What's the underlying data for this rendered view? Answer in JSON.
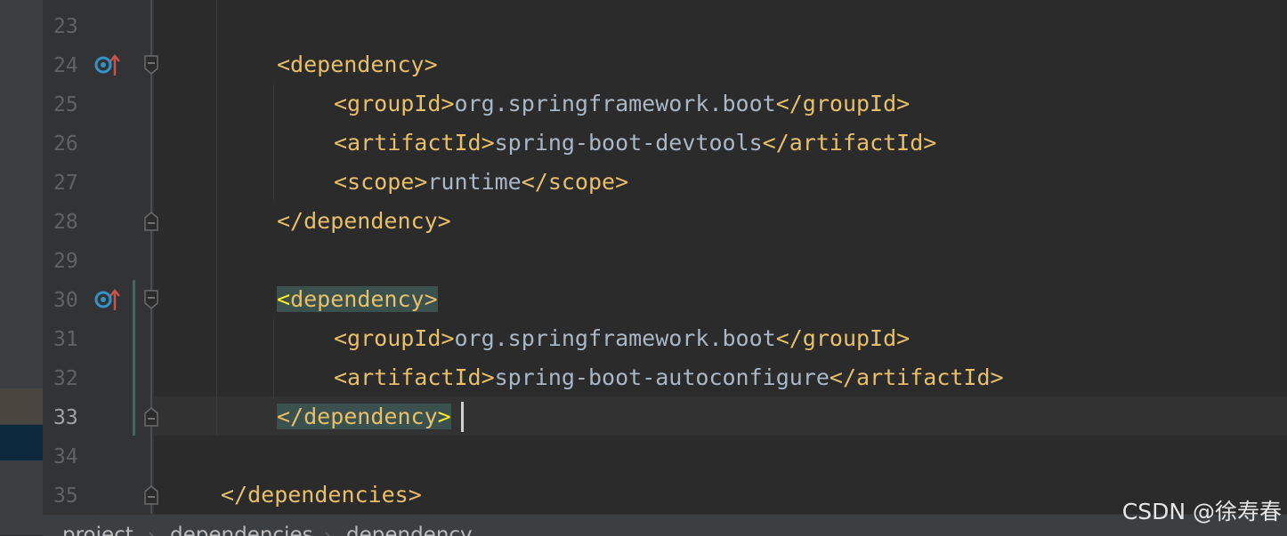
{
  "editor": {
    "lines": [
      {
        "number": "23"
      },
      {
        "number": "24",
        "tag_open": "<dependency>"
      },
      {
        "number": "25",
        "open": "<groupId>",
        "value": "org.springframework.boot",
        "close": "</groupId>"
      },
      {
        "number": "26",
        "open": "<artifactId>",
        "value": "spring-boot-devtools",
        "close": "</artifactId>"
      },
      {
        "number": "27",
        "open": "<scope>",
        "value": "runtime",
        "close": "</scope>"
      },
      {
        "number": "28",
        "tag_close": "</dependency>"
      },
      {
        "number": "29"
      },
      {
        "number": "30",
        "tag_open_lt": "<",
        "tag_open_rest": "dependency>"
      },
      {
        "number": "31",
        "open": "<groupId>",
        "value": "org.springframework.boot",
        "close": "</groupId>"
      },
      {
        "number": "32",
        "open": "<artifactId>",
        "value": "spring-boot-autoconfigure",
        "close": "</artifactId>"
      },
      {
        "number": "33",
        "tag_close_main": "</dependency",
        "tag_close_gt": ">"
      },
      {
        "number": "34"
      },
      {
        "number": "35",
        "tag_close": "</dependencies>"
      }
    ],
    "current_line": "33"
  },
  "gutter_icons": {
    "line_24": "maven-dependency-update-icon",
    "line_30": "maven-dependency-update-icon"
  },
  "breadcrumb": {
    "items": [
      "project",
      "dependencies",
      "dependency"
    ]
  },
  "watermark": "CSDN @徐寿春",
  "colors": {
    "background": "#2b2b2b",
    "tag": "#e8bf6a",
    "text": "#a9b7c6",
    "line_number": "#606366",
    "tag_highlight": "#3b514d",
    "bracket_match": "#ffef28"
  }
}
